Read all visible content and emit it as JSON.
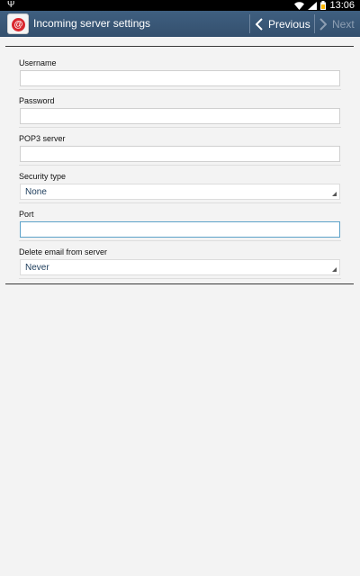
{
  "status_bar": {
    "usb_icon": "usb-icon",
    "wifi_icon": "wifi-icon",
    "signal_icon": "signal-icon",
    "battery_icon": "battery-icon",
    "time": "13:06"
  },
  "action_bar": {
    "app_icon": "email-app-icon",
    "app_icon_glyph": "@",
    "title": "Incoming server settings",
    "previous_label": "Previous",
    "next_label": "Next",
    "colors": {
      "bar": "#3b5877",
      "next_disabled": "#8e9fb3"
    }
  },
  "form": {
    "username": {
      "label": "Username",
      "value": ""
    },
    "password": {
      "label": "Password",
      "value": ""
    },
    "pop3_server": {
      "label": "POP3 server",
      "value": ""
    },
    "security_type": {
      "label": "Security type",
      "selected": "None"
    },
    "port": {
      "label": "Port",
      "value": ""
    },
    "delete_email": {
      "label": "Delete email from server",
      "selected": "Never"
    }
  }
}
